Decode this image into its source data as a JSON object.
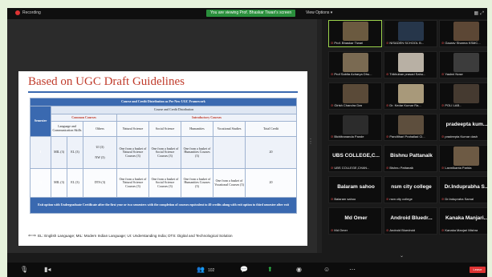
{
  "recording_label": "Recording",
  "viewing_label": "You are viewing Prof. Bhaskar Tiwari's screen",
  "view_options_label": "View Options ▾",
  "slide": {
    "title": "Based on UGC Draft Guidelines",
    "table_caption": "Course and Credit Distribution as Per New UGC Framework",
    "semester_label": "Semester",
    "cdd_label": "Course and Credit Distribution",
    "common_courses_label": "Common Courses",
    "introductory_courses_label": "Introductory Courses",
    "col_language": "Language and Communication Skills",
    "col_others": "Others",
    "col_natural": "Natural Science",
    "col_social": "Social Science",
    "col_humanities": "Humanities",
    "col_vocational": "Vocational Studies",
    "col_total": "Total Credit",
    "row1": {
      "sem": "I",
      "eng": "MIL (3)",
      "el": "EL (3)",
      "ui": "UI (3)",
      "nw": "NW (3)",
      "natural": "One from a basket of Natural Science Courses (3)",
      "social": "One from a basket of Social Science Courses (3)",
      "humanities": "One from a basket of Humanities Courses (3)",
      "vocational": "",
      "total": "20"
    },
    "row2": {
      "sem": "II",
      "eng": "MIL (3)",
      "el": "EL (3)",
      "dts": "DTS (3)",
      "natural": "One from a basket of Natural Science Courses (3)",
      "social": "One from a basket of Social Science Courses (3)",
      "humanities": "One from a basket of Humanities Courses (3)",
      "vocational": "One from a basket of Vocational Courses (3)",
      "total": "20"
    },
    "footer": "Exit option with Undergraduate Certificate after the first year or two semesters with the completion of courses equivalent to 40 credits along with exit option to third semester after exit",
    "footnote": "EL: English Language; MIL: Modern Indian Language; UI: Understanding India; DTS: Digital and Technological Solution"
  },
  "participants": [
    {
      "name": "Prof. Bhaskar Tiwari",
      "big": "",
      "active": true,
      "photo": "#6b5a40"
    },
    {
      "name": "NISADEN SCHOOL B...",
      "big": "",
      "active": false,
      "photo": "#26364a"
    },
    {
      "name": "Gaurav Sharma KSMC...",
      "big": "",
      "active": false,
      "photo": "#5c4735"
    },
    {
      "name": "Prof Sabita Acharya Dhu...",
      "big": "",
      "active": false,
      "photo": "#7a6a52"
    },
    {
      "name": "Tribhuban prasad Sahu...",
      "big": "",
      "active": false,
      "photo": "#b8b0a4"
    },
    {
      "name": "Yashni Nose",
      "big": "",
      "active": false,
      "photo": "#3c3c3c"
    },
    {
      "name": "Girish Chandra Das",
      "big": "",
      "active": false,
      "photo": "#5a4a38"
    },
    {
      "name": "Dr. Kedar Kumar Ra...",
      "big": "",
      "active": false,
      "photo": "#a8997a"
    },
    {
      "name": "POLI LAB...",
      "big": "",
      "active": false,
      "photo": "#453a30"
    },
    {
      "name": "Bichitrananda Pande",
      "big": "",
      "active": false,
      "photo": "#2c2c2c"
    },
    {
      "name": "Pandithari Prahallad Cl...",
      "big": "",
      "active": false,
      "photo": "#5d4e3d"
    },
    {
      "name": "pradeepta Kumar dash",
      "big": "pradeepta kum...",
      "active": false,
      "photo": ""
    },
    {
      "name": "UBS COLLEGE,CHAN...",
      "big": "UBS COLLEGE,C...",
      "active": false,
      "photo": ""
    },
    {
      "name": "Bishnu Pattanaik",
      "big": "Bishnu Pattanaik",
      "active": false,
      "photo": ""
    },
    {
      "name": "Laxmikanta Parida",
      "big": "",
      "active": false,
      "photo": "#6d5a44"
    },
    {
      "name": "Balaram sahoo",
      "big": "Balaram sahoo",
      "active": false,
      "photo": ""
    },
    {
      "name": "nsm city college",
      "big": "nsm city college",
      "active": false,
      "photo": ""
    },
    {
      "name": "Dr.Indupraha Samal",
      "big": "Dr.Induprabha S...",
      "active": false,
      "photo": ""
    },
    {
      "name": "Md Omer",
      "big": "Md Omer",
      "active": false,
      "photo": ""
    },
    {
      "name": "Android Bluedroid",
      "big": "Android Bluedr...",
      "active": false,
      "photo": ""
    },
    {
      "name": "Kanaka Manjari Mishra",
      "big": "Kanaka Manjari...",
      "active": false,
      "photo": ""
    }
  ],
  "controls": {
    "participants_count": "102",
    "leave_label": "Leave"
  }
}
